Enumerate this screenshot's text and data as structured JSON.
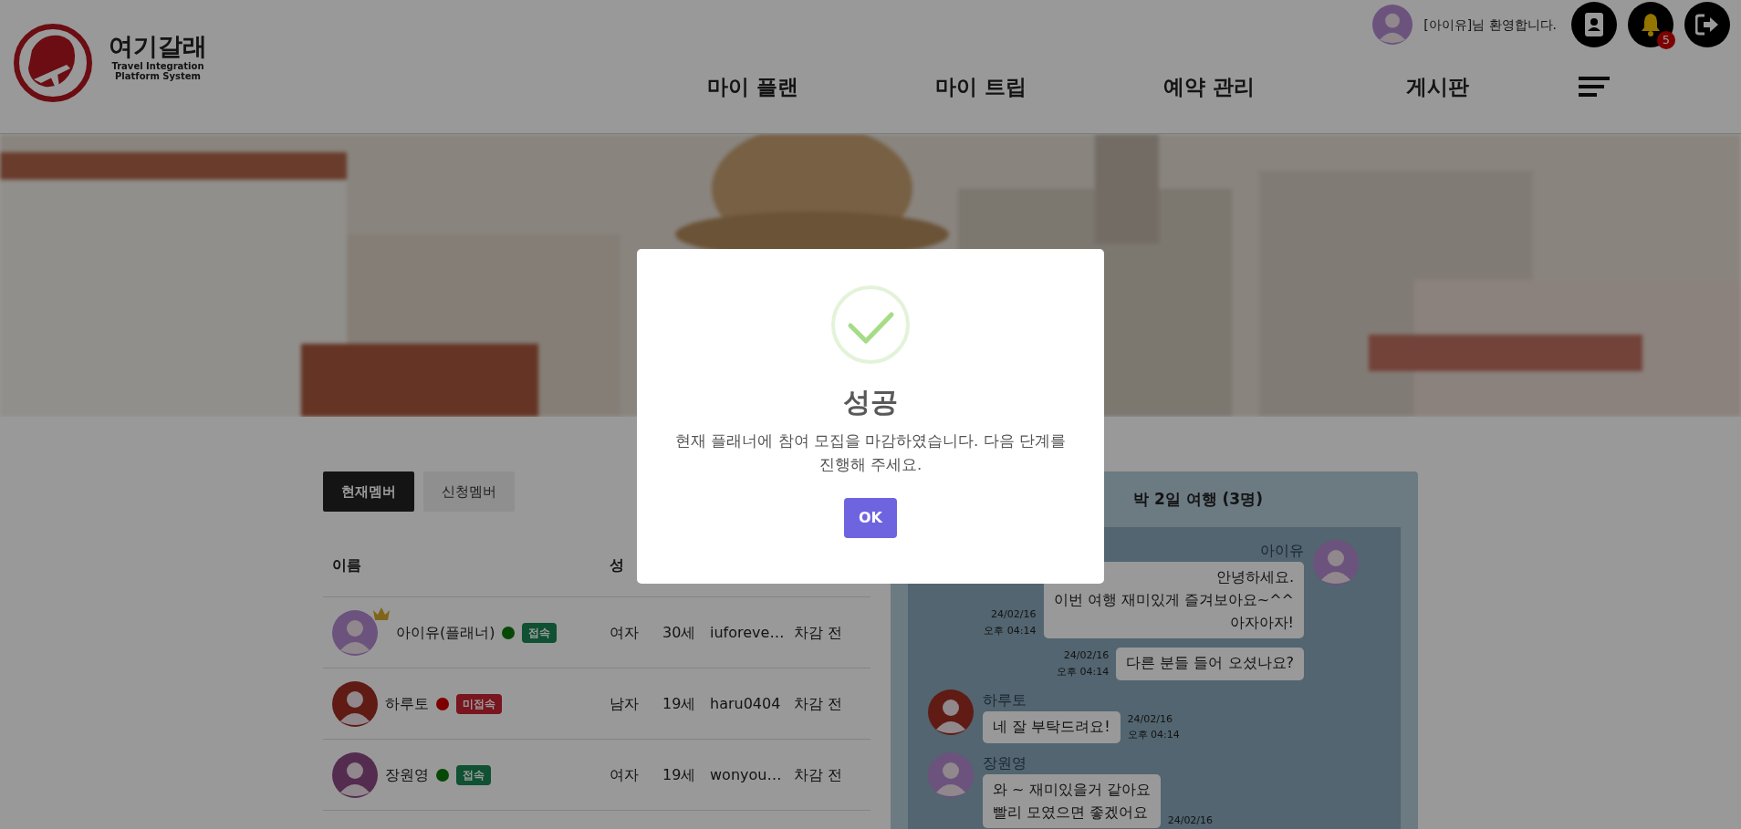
{
  "header": {
    "logo_title": "여기갈래",
    "logo_subtitle": [
      "Travel Integration",
      "Platform System"
    ],
    "welcome": "[아이유]님 환영합니다.",
    "notification_count": "5",
    "nav": [
      "마이 플랜",
      "마이 트립",
      "예약 관리",
      "게시판"
    ]
  },
  "tabs": [
    {
      "label": "현재멤버",
      "selected": true
    },
    {
      "label": "신청멤버",
      "selected": false
    }
  ],
  "members": {
    "columns": [
      "이름",
      "성"
    ],
    "rows": [
      {
        "name": "아이유(플래너)",
        "planner": true,
        "online": true,
        "badge": "접속",
        "gender": "여자",
        "age": "30세",
        "id": "iuforeve…",
        "status": "차감 전"
      },
      {
        "name": "하루토",
        "planner": false,
        "online": false,
        "badge": "미접속",
        "gender": "남자",
        "age": "19세",
        "id": "haru0404",
        "status": "차감 전"
      },
      {
        "name": "장원영",
        "planner": false,
        "online": true,
        "badge": "접속",
        "gender": "여자",
        "age": "19세",
        "id": "wonyou…",
        "status": "차감 전"
      }
    ]
  },
  "chat": {
    "title": "박 2일 여행 (3명)",
    "messages": [
      {
        "kind": "mine",
        "sender": "아이유",
        "lines": [
          "안녕하세요.",
          "이번 여행 재미있게 즐겨보아요~^^",
          "아자아자!"
        ],
        "date": "24/02/16",
        "time": "오후 04:14"
      },
      {
        "kind": "mine",
        "lines": [
          "다른 분들 들어 오셨나요?"
        ],
        "date": "24/02/16",
        "time": "오후 04:14"
      },
      {
        "kind": "other",
        "sender": "하루토",
        "lines": [
          "네 잘 부탁드려요!"
        ],
        "date": "24/02/16",
        "time": "오후 04:14"
      },
      {
        "kind": "other",
        "sender": "장원영",
        "lines": [
          "와 ~ 재미있을거 같아요",
          "빨리 모였으면 좋겠어요"
        ],
        "date": "24/02/16"
      }
    ]
  },
  "dialog": {
    "title": "성공",
    "message": "현재 플래너에 참여 모집을 마감하였습니다. 다음 단계를 진행해 주세요.",
    "button": "OK"
  }
}
